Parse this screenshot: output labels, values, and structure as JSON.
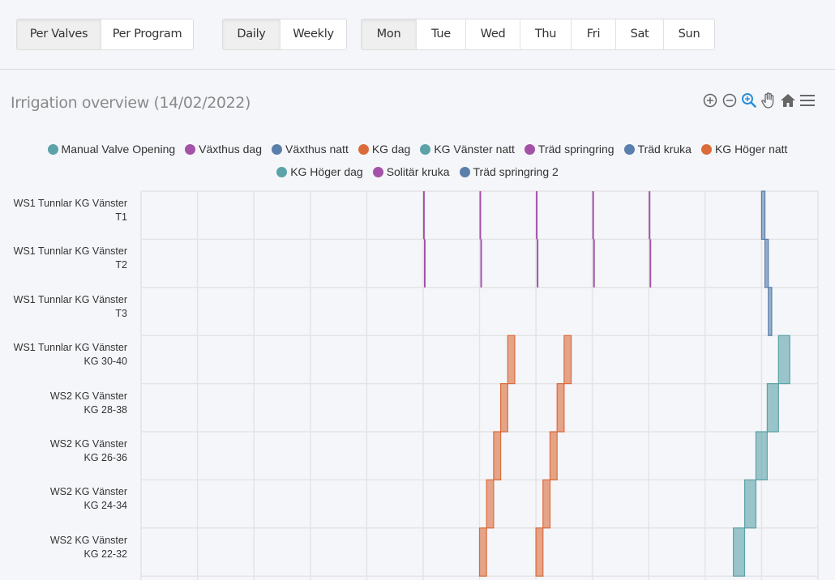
{
  "toolbar": {
    "view_mode": [
      {
        "label": "Per Valves",
        "active": true
      },
      {
        "label": "Per Program",
        "active": false
      }
    ],
    "period": [
      {
        "label": "Daily",
        "active": true
      },
      {
        "label": "Weekly",
        "active": false
      }
    ],
    "days": [
      {
        "label": "Mon",
        "active": true
      },
      {
        "label": "Tue",
        "active": false
      },
      {
        "label": "Wed",
        "active": false
      },
      {
        "label": "Thu",
        "active": false
      },
      {
        "label": "Fri",
        "active": false
      },
      {
        "label": "Sat",
        "active": false
      },
      {
        "label": "Sun",
        "active": false
      }
    ]
  },
  "chart": {
    "title": "Irrigation overview (14/02/2022)",
    "tools": [
      "zoom-in-icon",
      "zoom-out-icon",
      "selection-zoom-icon",
      "pan-hand-icon",
      "reset-home-icon",
      "menu-icon"
    ]
  },
  "chart_data": {
    "type": "timeline",
    "title": "Irrigation overview (14/02/2022)",
    "x_unit": "hour of day",
    "xlim": [
      0,
      24
    ],
    "x_grid_interval_hours": 2,
    "grid": true,
    "legend_position": "top-center",
    "legend": [
      {
        "name": "Manual Valve Opening",
        "color": "#5ba3a8"
      },
      {
        "name": "Växthus dag",
        "color": "#a352a8"
      },
      {
        "name": "Växthus natt",
        "color": "#5a7fab"
      },
      {
        "name": "KG dag",
        "color": "#da6c3b"
      },
      {
        "name": "KG Vänster natt",
        "color": "#5ba3a8"
      },
      {
        "name": "Träd springring",
        "color": "#a352a8"
      },
      {
        "name": "Träd kruka",
        "color": "#5a7fab"
      },
      {
        "name": "KG Höger natt",
        "color": "#da6c3b"
      },
      {
        "name": "KG Höger dag",
        "color": "#5ba3a8"
      },
      {
        "name": "Solitär kruka",
        "color": "#a352a8"
      },
      {
        "name": "Träd springring 2",
        "color": "#5a7fab"
      }
    ],
    "rows": [
      {
        "label_line1": "WS1 Tunnlar KG Vänster",
        "label_line2": "T1"
      },
      {
        "label_line1": "WS1 Tunnlar KG Vänster",
        "label_line2": "T2"
      },
      {
        "label_line1": "WS1 Tunnlar KG Vänster",
        "label_line2": "T3"
      },
      {
        "label_line1": "WS1 Tunnlar KG Vänster",
        "label_line2": "KG 30-40"
      },
      {
        "label_line1": "WS2 KG Vänster",
        "label_line2": "KG 28-38"
      },
      {
        "label_line1": "WS2 KG Vänster",
        "label_line2": "KG 26-36"
      },
      {
        "label_line1": "WS2 KG Vänster",
        "label_line2": "KG 24-34"
      },
      {
        "label_line1": "WS2 KG Vänster",
        "label_line2": "KG 22-32"
      }
    ],
    "segments": [
      {
        "row": 0,
        "series": "Växthus dag",
        "start": 10.0,
        "end": 10.03
      },
      {
        "row": 0,
        "series": "Växthus dag",
        "start": 12.0,
        "end": 12.03
      },
      {
        "row": 0,
        "series": "Växthus dag",
        "start": 14.0,
        "end": 14.03
      },
      {
        "row": 0,
        "series": "Växthus dag",
        "start": 16.0,
        "end": 16.03
      },
      {
        "row": 0,
        "series": "Växthus dag",
        "start": 18.0,
        "end": 18.03
      },
      {
        "row": 1,
        "series": "Växthus dag",
        "start": 10.03,
        "end": 10.06
      },
      {
        "row": 1,
        "series": "Växthus dag",
        "start": 12.03,
        "end": 12.06
      },
      {
        "row": 1,
        "series": "Växthus dag",
        "start": 14.03,
        "end": 14.06
      },
      {
        "row": 1,
        "series": "Växthus dag",
        "start": 16.03,
        "end": 16.06
      },
      {
        "row": 1,
        "series": "Växthus dag",
        "start": 18.03,
        "end": 18.06
      },
      {
        "row": 0,
        "series": "Växthus natt",
        "start": 22.0,
        "end": 22.12
      },
      {
        "row": 1,
        "series": "Växthus natt",
        "start": 22.12,
        "end": 22.24
      },
      {
        "row": 2,
        "series": "Växthus natt",
        "start": 22.24,
        "end": 22.36
      },
      {
        "row": 7,
        "series": "KG dag",
        "start": 12.0,
        "end": 12.25
      },
      {
        "row": 6,
        "series": "KG dag",
        "start": 12.25,
        "end": 12.5
      },
      {
        "row": 5,
        "series": "KG dag",
        "start": 12.5,
        "end": 12.75
      },
      {
        "row": 4,
        "series": "KG dag",
        "start": 12.75,
        "end": 13.0
      },
      {
        "row": 3,
        "series": "KG dag",
        "start": 13.0,
        "end": 13.25
      },
      {
        "row": 7,
        "series": "KG dag",
        "start": 14.0,
        "end": 14.25
      },
      {
        "row": 6,
        "series": "KG dag",
        "start": 14.25,
        "end": 14.5
      },
      {
        "row": 5,
        "series": "KG dag",
        "start": 14.5,
        "end": 14.75
      },
      {
        "row": 4,
        "series": "KG dag",
        "start": 14.75,
        "end": 15.0
      },
      {
        "row": 3,
        "series": "KG dag",
        "start": 15.0,
        "end": 15.25
      },
      {
        "row": 7,
        "series": "KG Vänster natt",
        "start": 21.0,
        "end": 21.4
      },
      {
        "row": 6,
        "series": "KG Vänster natt",
        "start": 21.4,
        "end": 21.8
      },
      {
        "row": 5,
        "series": "KG Vänster natt",
        "start": 21.8,
        "end": 22.2
      },
      {
        "row": 4,
        "series": "KG Vänster natt",
        "start": 22.2,
        "end": 22.6
      },
      {
        "row": 3,
        "series": "KG Vänster natt",
        "start": 22.6,
        "end": 23.0
      }
    ]
  }
}
